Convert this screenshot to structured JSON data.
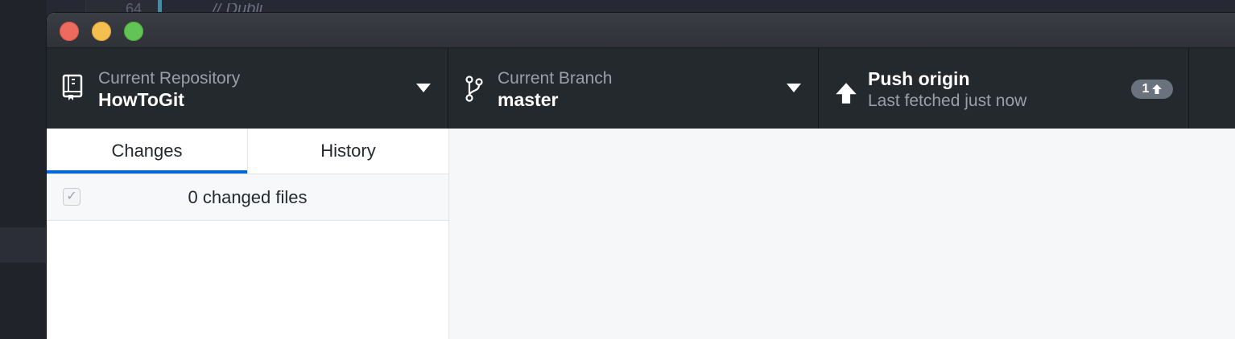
{
  "background_editor": {
    "line_number": "64",
    "code_fragment": "// Dubli"
  },
  "window": {
    "traffic_lights": {
      "close_color": "#ed6a5e",
      "minimize_color": "#f5bf4f",
      "zoom_color": "#61c454"
    }
  },
  "toolbar": {
    "repository": {
      "label": "Current Repository",
      "value": "HowToGit",
      "icon": "repo-icon"
    },
    "branch": {
      "label": "Current Branch",
      "value": "master",
      "icon": "git-branch-icon"
    },
    "push": {
      "title": "Push origin",
      "subtitle": "Last fetched just now",
      "icon": "arrow-up-icon",
      "badge_count": "1"
    }
  },
  "sidebar": {
    "tabs": [
      {
        "label": "Changes",
        "active": true
      },
      {
        "label": "History",
        "active": false
      }
    ],
    "changes": {
      "count_text": "0 changed files",
      "select_all_checked": true
    }
  },
  "colors": {
    "toolbar_bg": "#24292e",
    "accent_blue": "#0366d6",
    "badge_bg": "#6a737d"
  }
}
